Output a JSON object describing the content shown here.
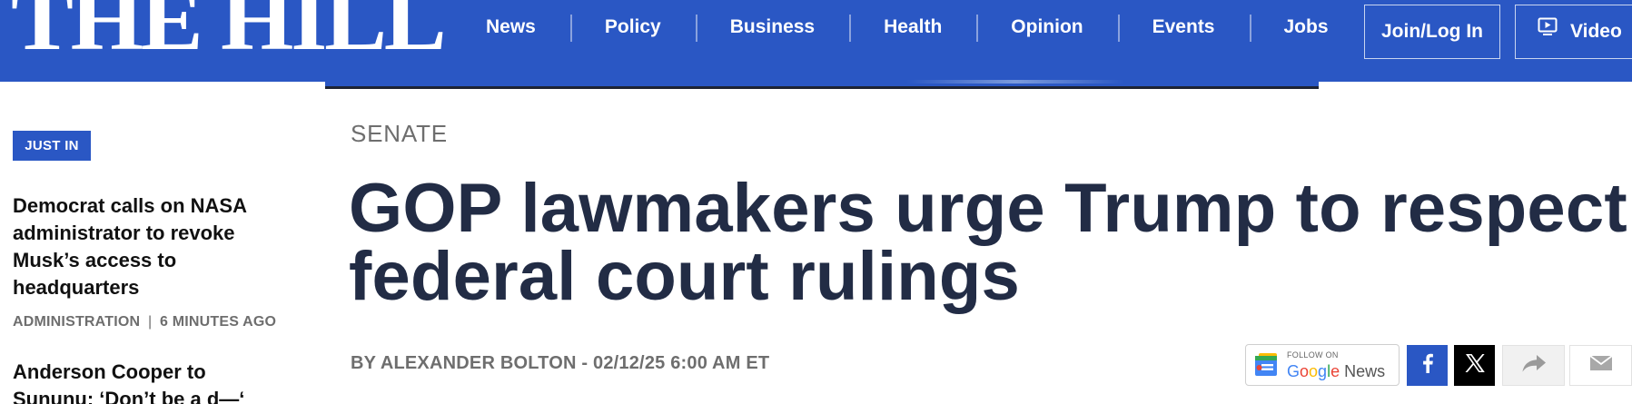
{
  "header": {
    "logo_text": "THE HILL",
    "nav": [
      {
        "label": "News"
      },
      {
        "label": "Policy"
      },
      {
        "label": "Business"
      },
      {
        "label": "Health"
      },
      {
        "label": "Opinion"
      },
      {
        "label": "Events"
      },
      {
        "label": "Jobs"
      }
    ],
    "join_label": "Join/Log In",
    "video_label": "Video",
    "video_icon": "play-icon"
  },
  "sidebar": {
    "badge": "JUST IN",
    "items": [
      {
        "headline": "Democrat calls on NASA administrator to revoke Musk’s access to headquarters",
        "category": "ADMINISTRATION",
        "separator": "|",
        "time": "6 MINUTES AGO"
      },
      {
        "headline": "Anderson Cooper to Sununu: ‘Don’t be a d—‘"
      }
    ]
  },
  "article": {
    "section": "SENATE",
    "title": "GOP lawmakers urge Trump to respect federal court rulings",
    "byline": "BY ALEXANDER BOLTON - 02/12/25 6:00 AM ET"
  },
  "share": {
    "google_news_follow": "FOLLOW ON",
    "google_news_brand": [
      "G",
      "o",
      "o",
      "g",
      "l",
      "e"
    ],
    "google_news_suffix": " News",
    "buttons": [
      {
        "name": "facebook-icon",
        "glyph": "f"
      },
      {
        "name": "x-icon",
        "glyph": "X"
      },
      {
        "name": "share-arrow-icon",
        "glyph": ""
      },
      {
        "name": "email-icon",
        "glyph": ""
      }
    ]
  },
  "colors": {
    "brand_blue": "#2a57c4",
    "headline_navy": "#222c45",
    "meta_gray": "#6e6e6e"
  }
}
